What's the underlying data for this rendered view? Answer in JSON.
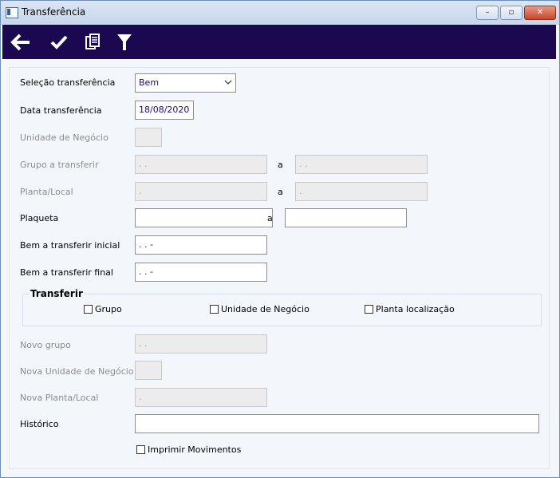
{
  "window": {
    "title": "Transferência",
    "controls": {
      "minimize": "–",
      "maximize": "▫",
      "close": "✕"
    }
  },
  "toolbar": {
    "buttons": [
      {
        "name": "back",
        "icon": "arrow-left-icon"
      },
      {
        "name": "confirm",
        "icon": "check-icon"
      },
      {
        "name": "copy",
        "icon": "documents-icon"
      },
      {
        "name": "filter",
        "icon": "filter-icon"
      }
    ]
  },
  "form": {
    "selecao": {
      "label": "Seleção transferência",
      "value": "Bem"
    },
    "data": {
      "label": "Data transferência",
      "value": "18/08/2020"
    },
    "unidade": {
      "label": "Unidade de Negócio",
      "value": ""
    },
    "grupo": {
      "label": "Grupo a transferir",
      "from": ". .",
      "sep": "a",
      "to": ". ."
    },
    "planta": {
      "label": "Planta/Local",
      "from": ".",
      "sep": "a",
      "to": "."
    },
    "plaqueta": {
      "label": "Plaqueta",
      "from": "",
      "sep": "a",
      "to": ""
    },
    "bem_inicial": {
      "label": "Bem a transferir inicial",
      "value": ". .  -"
    },
    "bem_final": {
      "label": "Bem a transferir final",
      "value": ". .  -"
    },
    "transferir": {
      "title": "Transferir",
      "options": [
        "Grupo",
        "Unidade de Negócio",
        "Planta localização"
      ]
    },
    "novo_grupo": {
      "label": "Novo grupo",
      "value": ". ."
    },
    "nova_unidade": {
      "label": "Nova Unidade de Negócio",
      "value": ""
    },
    "nova_planta": {
      "label": "Nova Planta/Local",
      "value": "."
    },
    "historico": {
      "label": "Histórico",
      "value": ""
    },
    "imprimir": {
      "label": "Imprimir Movimentos"
    }
  },
  "colors": {
    "toolbar": "#1b0850",
    "titlebar": "#c6d6ec",
    "input_text": "#1b0a7a"
  }
}
